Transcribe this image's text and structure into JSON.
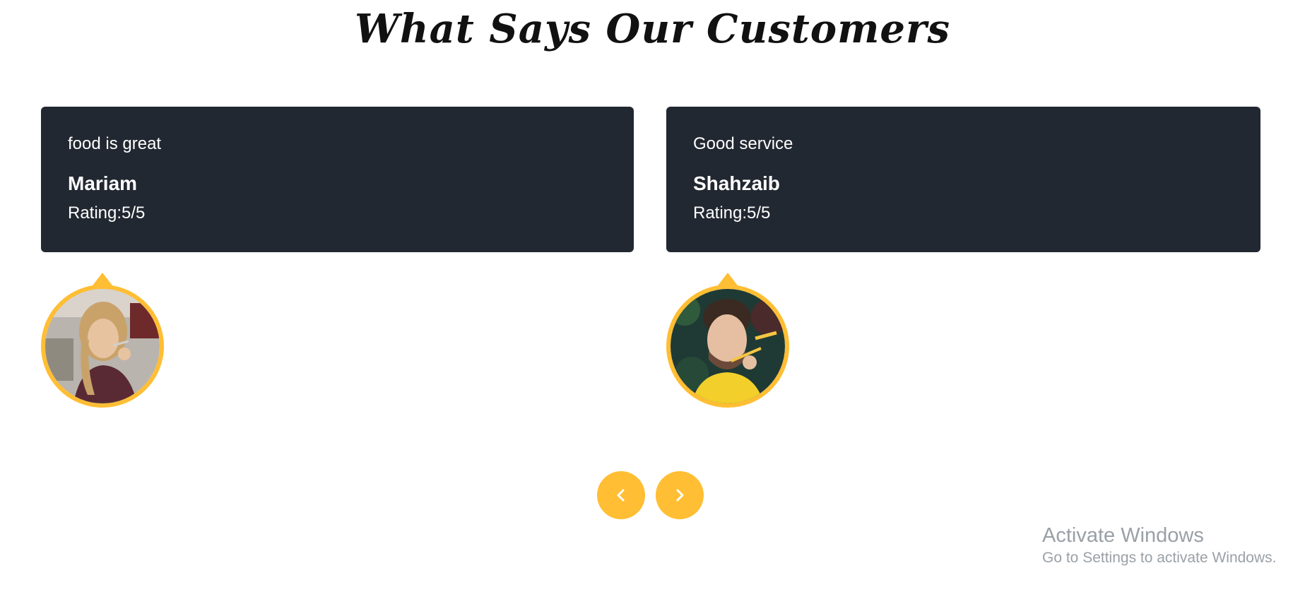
{
  "section": {
    "title": "What Says Our Customers"
  },
  "testimonials": [
    {
      "review": "food is great",
      "name": "Mariam",
      "rating": "Rating:5/5",
      "avatar_icon": "customer-photo-woman"
    },
    {
      "review": "Good service",
      "name": "Shahzaib",
      "rating": "Rating:5/5",
      "avatar_icon": "customer-photo-man"
    }
  ],
  "navigation": {
    "prev_icon": "chevron-left-icon",
    "next_icon": "chevron-right-icon"
  },
  "watermark": {
    "title": "Activate Windows",
    "subtitle": "Go to Settings to activate Windows."
  },
  "colors": {
    "card_bg": "#222831",
    "accent": "#ffbe33",
    "text_light": "#ffffff",
    "watermark": "#9aa0a6"
  }
}
